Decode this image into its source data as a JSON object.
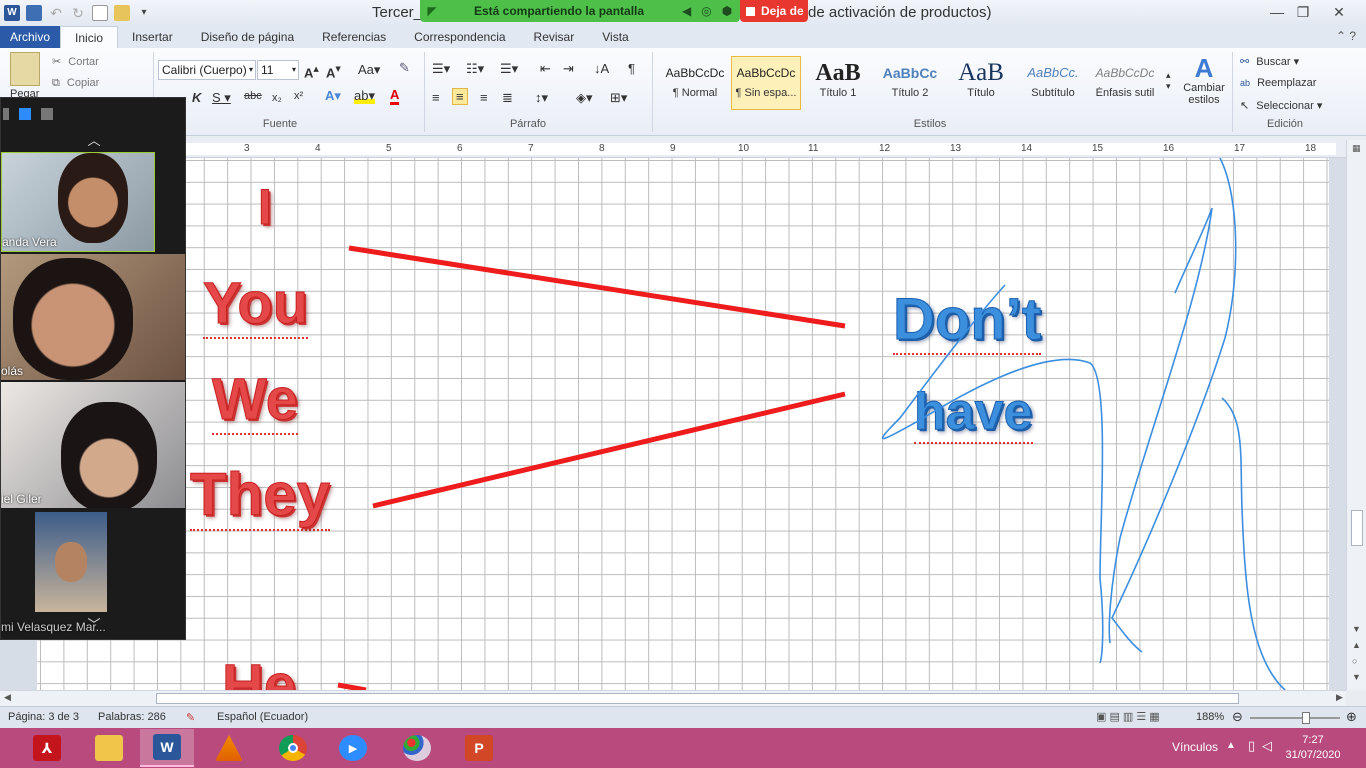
{
  "window": {
    "title_left": "Tercer_",
    "title_right": "de activación de productos)",
    "controls": [
      "minimize-icon",
      "restore-icon",
      "close-icon"
    ]
  },
  "share_banner": {
    "text": "Está compartiendo la pantalla",
    "stop_label": "Deja de"
  },
  "ribbon_tabs": [
    "Archivo",
    "Inicio",
    "Insertar",
    "Diseño de página",
    "Referencias",
    "Correspondencia",
    "Revisar",
    "Vista"
  ],
  "clipboard": {
    "paste": "Pegar",
    "cut": "Cortar",
    "copy": "Copiar"
  },
  "font": {
    "name": "Calibri (Cuerpo)",
    "size": "11",
    "group_label": "Fuente"
  },
  "paragraph": {
    "group_label": "Párrafo"
  },
  "styles": {
    "group_label": "Estilos",
    "items": [
      {
        "preview": "AaBbCcDc",
        "name": "¶ Normal"
      },
      {
        "preview": "AaBbCcDc",
        "name": "¶ Sin espa..."
      },
      {
        "preview": "AaB",
        "name": "Título 1"
      },
      {
        "preview": "AaBbCc",
        "name": "Título 2"
      },
      {
        "preview": "AaB",
        "name": "Título"
      },
      {
        "preview": "AaBbCc.",
        "name": "Subtítulo"
      },
      {
        "preview": "AaBbCcDc",
        "name": "Énfasis sutil"
      }
    ],
    "change_label_1": "Cambiar",
    "change_label_2": "estilos"
  },
  "editing": {
    "group_label": "Edición",
    "find": "Buscar",
    "replace": "Reemplazar",
    "select": "Seleccionar"
  },
  "ruler": [
    "3",
    "4",
    "5",
    "6",
    "7",
    "8",
    "9",
    "10",
    "11",
    "12",
    "13",
    "14",
    "15",
    "16",
    "17",
    "18"
  ],
  "document": {
    "pronouns": [
      "I",
      "You",
      "We",
      "They",
      "He"
    ],
    "phrase": [
      "Don’t",
      "have"
    ]
  },
  "gallery": {
    "participants": [
      {
        "name": "anda Vera"
      },
      {
        "name": "olás"
      },
      {
        "name": "iel Giler"
      },
      {
        "name": "mi Velasquez Mar..."
      }
    ]
  },
  "status": {
    "page": "Página: 3 de 3",
    "words": "Palabras: 286",
    "language": "Español (Ecuador)",
    "zoom": "188%"
  },
  "taskbar": {
    "apps": [
      "acrobat-icon",
      "file-explorer-icon",
      "word-icon",
      "vlc-icon",
      "chrome-icon",
      "zoom-icon",
      "paint-icon",
      "powerpoint-icon"
    ],
    "tray_label": "Vínculos",
    "time": "7:27",
    "date": "31/07/2020"
  }
}
